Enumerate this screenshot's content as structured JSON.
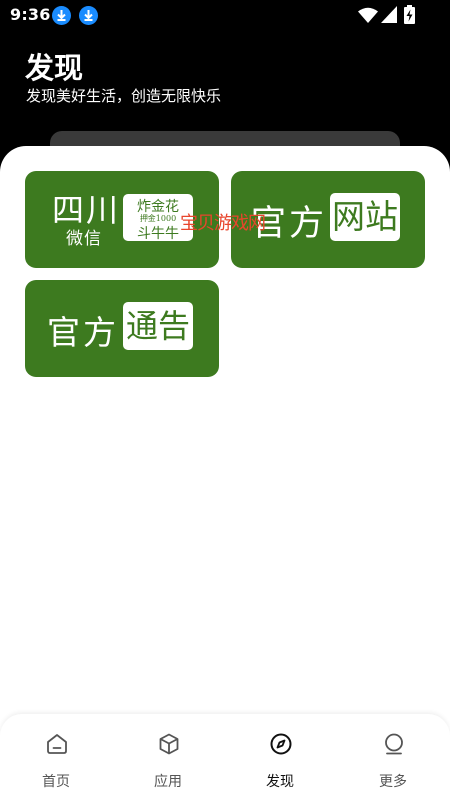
{
  "status_bar": {
    "time": "9:36",
    "icons": [
      "download-icon",
      "download-icon",
      "wifi-icon",
      "signal-icon",
      "battery-charging-icon"
    ]
  },
  "header": {
    "title": "发现",
    "subtitle": "发现美好生活，创造无限快乐"
  },
  "tiles": [
    {
      "name": "sichuan-wechat-tile",
      "big_text": "四川",
      "small_text": "微信",
      "box_line1": "炸金花",
      "box_line2": "押金1000",
      "box_line3": "斗牛牛"
    },
    {
      "name": "official-website-tile",
      "big_text": "官方",
      "box_text": "网站"
    },
    {
      "name": "official-notice-tile",
      "big_text": "官方",
      "box_text": "通告"
    }
  ],
  "watermark": "宝贝游戏网",
  "bottom_nav": {
    "items": [
      {
        "label": "首页",
        "icon": "home-icon",
        "active": false
      },
      {
        "label": "应用",
        "icon": "cube-icon",
        "active": false
      },
      {
        "label": "发现",
        "icon": "compass-icon",
        "active": true
      },
      {
        "label": "更多",
        "icon": "more-icon",
        "active": false
      }
    ]
  },
  "colors": {
    "tile_green": "#3d7a1f",
    "header_bg": "#000000",
    "watermark": "#e8452c",
    "status_accent": "#1a8cff"
  }
}
